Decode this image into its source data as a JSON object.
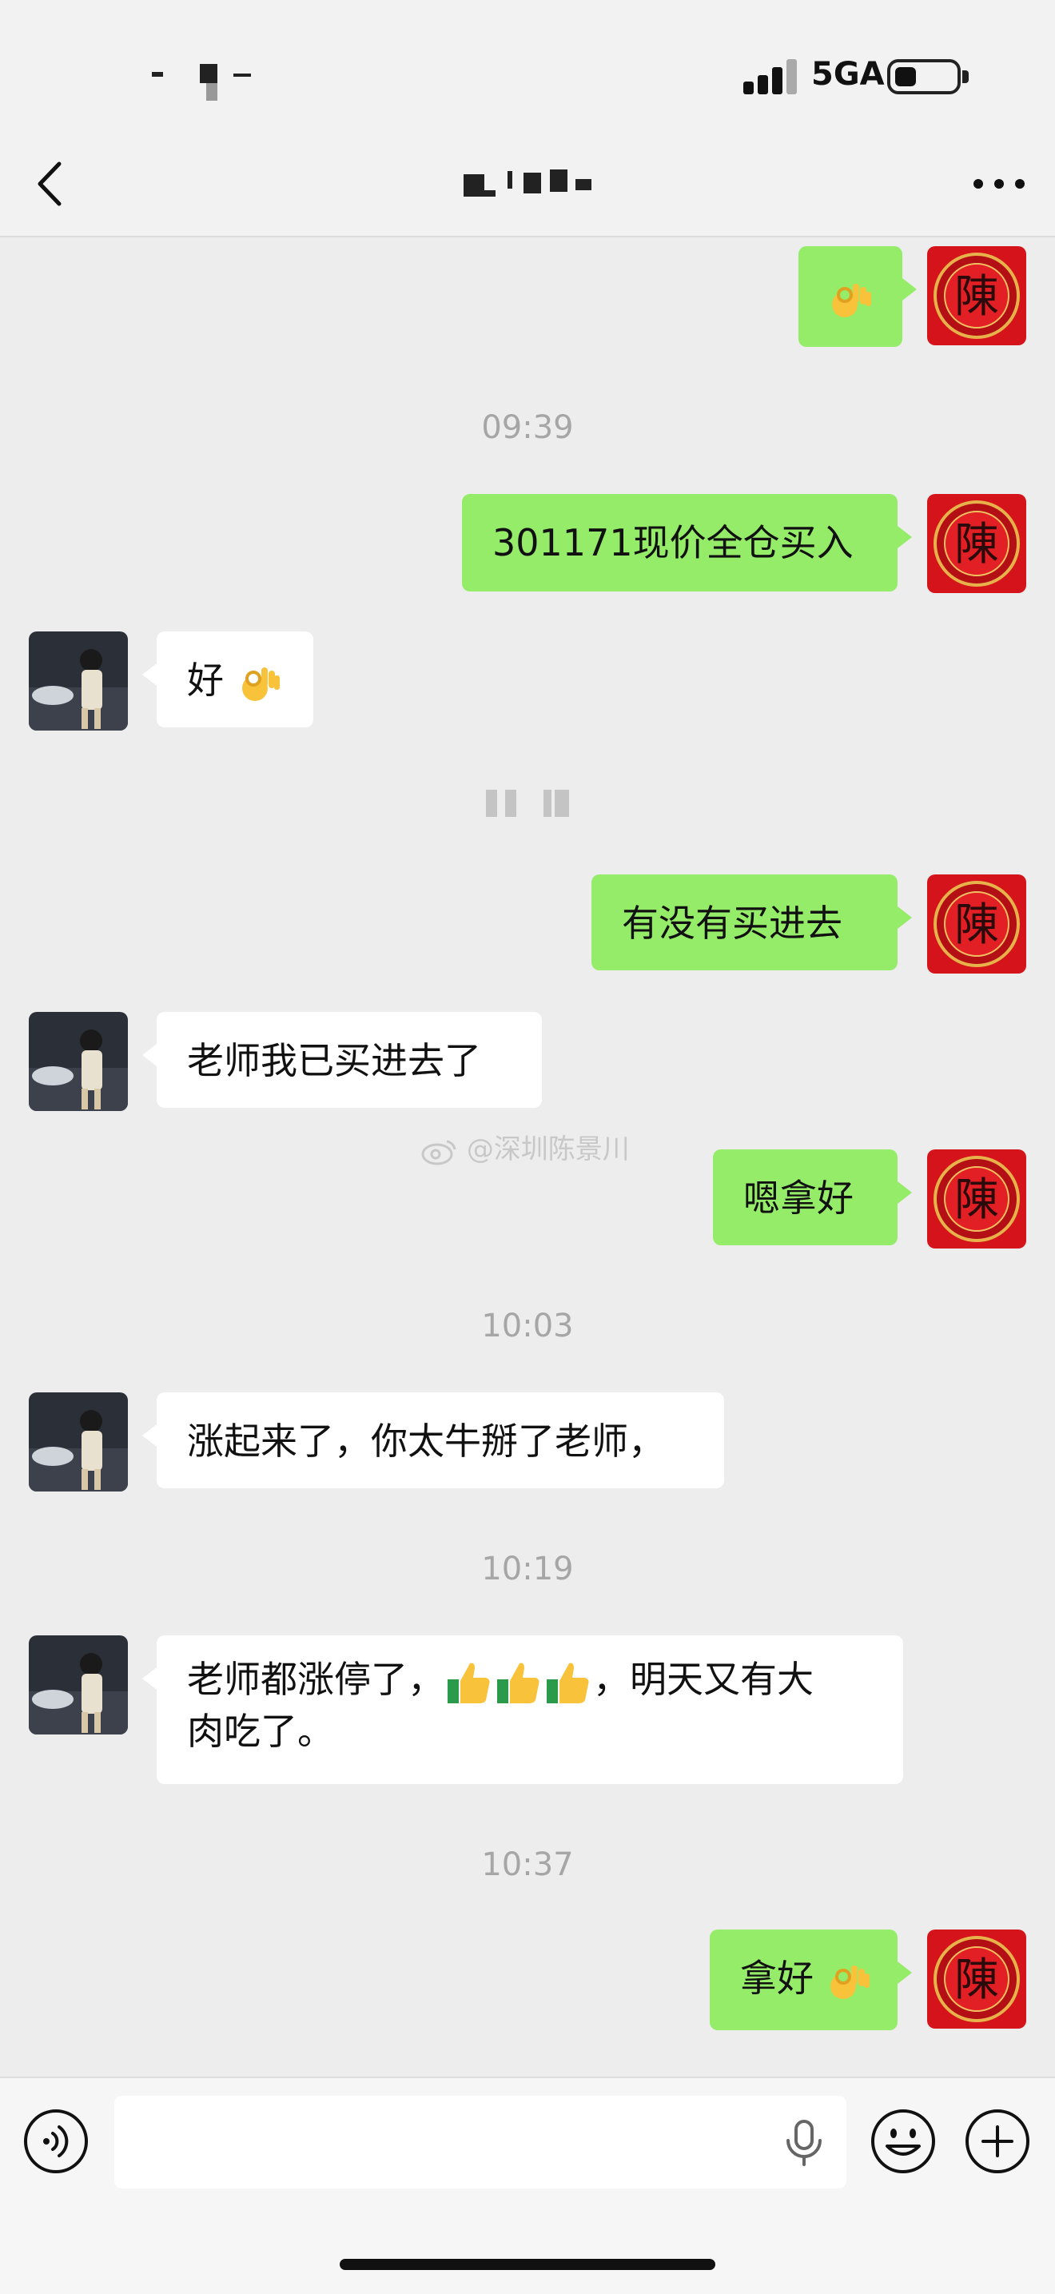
{
  "status_bar": {
    "network": "5GA",
    "icons": {
      "signal": "signal-bars-icon",
      "battery": "battery-icon"
    }
  },
  "nav": {
    "icons": {
      "back": "chevron-left-icon",
      "more": "more-dots-icon"
    }
  },
  "messages": [
    {
      "type": "sent",
      "emoji": "ok-hand",
      "text": ""
    },
    {
      "type": "timestamp",
      "text": "09:39"
    },
    {
      "type": "sent",
      "text": "301171现价全仓买入"
    },
    {
      "type": "received",
      "text": "好",
      "emoji": "ok-hand"
    },
    {
      "type": "sent",
      "text": "有没有买进去"
    },
    {
      "type": "received",
      "text": "老师我已买进去了"
    },
    {
      "type": "sent",
      "text": "嗯拿好"
    },
    {
      "type": "timestamp",
      "text": "10:03"
    },
    {
      "type": "received",
      "text": "涨起来了，你太牛掰了老师，"
    },
    {
      "type": "timestamp",
      "text": "10:19"
    },
    {
      "type": "received",
      "text_before": "老师都涨停了，",
      "emoji": "thumbs-up x3",
      "text_after": "，明天又有大",
      "text_line2": "肉吃了。"
    },
    {
      "type": "timestamp",
      "text": "10:37"
    },
    {
      "type": "sent",
      "text": "拿好",
      "emoji": "ok-hand"
    }
  ],
  "watermark": "@深圳陈景川",
  "input_bar": {
    "placeholder": "",
    "icons": {
      "voice": "voice-icon",
      "mic": "mic-icon",
      "emoji": "smiley-icon",
      "add": "plus-icon"
    }
  },
  "colors": {
    "sent_bubble": "#95ec69",
    "received_bubble": "#ffffff",
    "background": "#ededed",
    "avatar_red": "#d4141a"
  }
}
